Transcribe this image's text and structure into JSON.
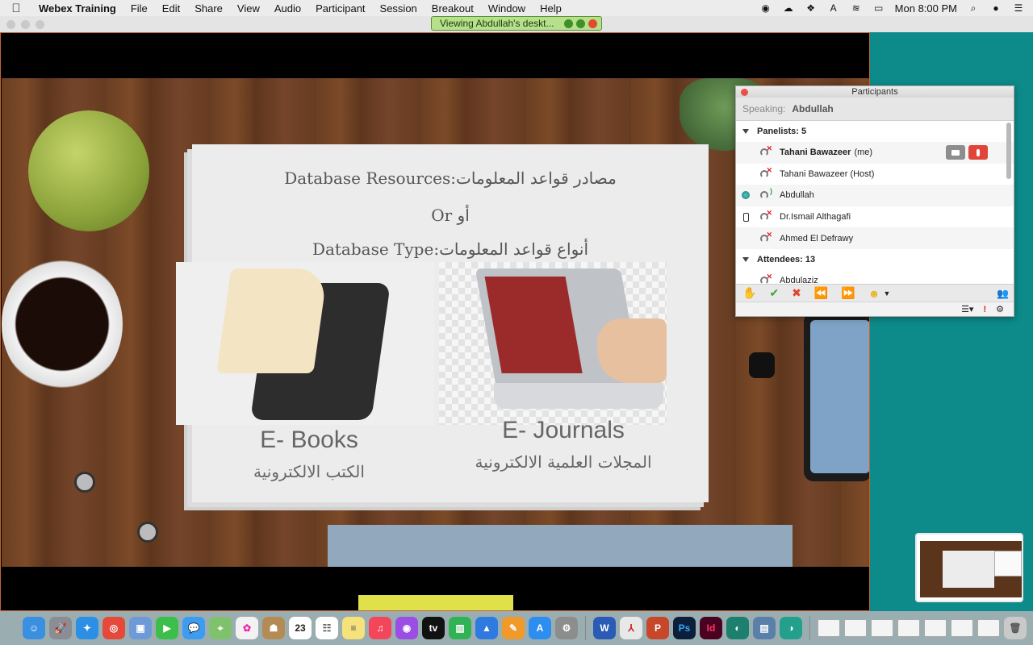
{
  "menubar": {
    "app_name": "Webex Training",
    "items": [
      "File",
      "Edit",
      "Share",
      "View",
      "Audio",
      "Participant",
      "Session",
      "Breakout",
      "Window",
      "Help"
    ],
    "clock": "Mon 8:00 PM"
  },
  "viewing_banner": "Viewing Abdullah's deskt...",
  "slide": {
    "title": "Database Resources:مصادر قواعد المعلومات",
    "or_line": "Or أو",
    "type_line": "Database Type:أنواع قواعد المعلومات",
    "ebooks": "E- Books",
    "ebooks_ar": "الكتب الالكترونية",
    "journals": "E- Journals",
    "journals_ar": "المجلات العلمية الالكترونية"
  },
  "participants": {
    "title": "Participants",
    "speaking_label": "Speaking:",
    "speaking_name": "Abdullah",
    "panelists_header": "Panelists: 5",
    "attendees_header": "Attendees: 13",
    "panelists": [
      {
        "name": "Tahani Bawazeer",
        "suffix": "(me)"
      },
      {
        "name": "Tahani Bawazeer (Host)"
      },
      {
        "name": "Abdullah"
      },
      {
        "name": "Dr.Ismail Althagafi"
      },
      {
        "name": "Ahmed El Defrawy"
      }
    ],
    "attendees": [
      {
        "name": "Abdulaziz"
      }
    ]
  },
  "dock": {
    "calendar_day": "23",
    "apps": [
      "finder-icon",
      "launchpad-icon",
      "safari-icon",
      "chrome-icon",
      "preview-icon",
      "facetime-icon",
      "messages-icon",
      "maps-icon",
      "photos-icon",
      "contacts-icon",
      "calendar-icon",
      "reminders-icon",
      "notes-icon",
      "music-icon",
      "podcasts-icon",
      "tv-icon",
      "numbers-icon",
      "keynote-icon",
      "pages-icon",
      "appstore-icon",
      "settings-icon",
      "word-icon",
      "acrobat-icon",
      "powerpoint-icon",
      "photoshop-icon",
      "indesign-icon",
      "webex-icon",
      "image-capture-icon",
      "webex-meetings-icon"
    ],
    "labels": {
      "tv": "tv",
      "word": "W",
      "powerpoint": "P",
      "photoshop": "Ps",
      "indesign": "Id"
    }
  }
}
